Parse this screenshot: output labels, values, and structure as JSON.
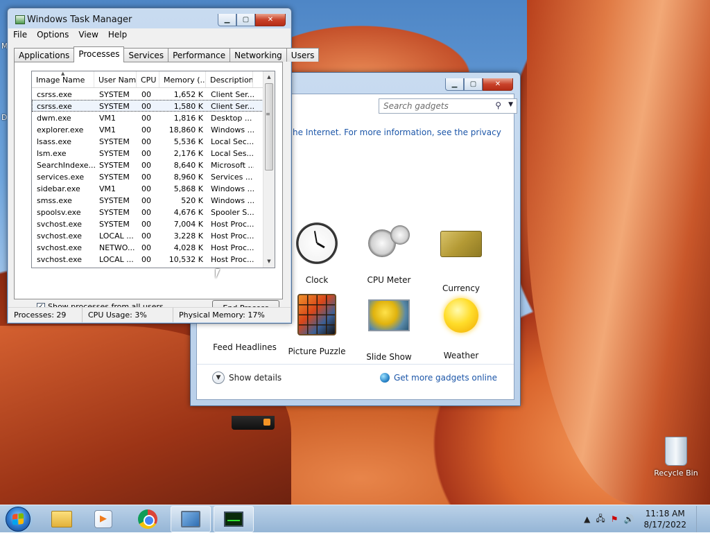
{
  "desktop": {
    "side_letters": [
      "M",
      "D"
    ],
    "recycle_bin": "Recycle Bin"
  },
  "gadgets_window": {
    "search_placeholder": "Search gadgets",
    "info_text": "he Internet.  For more information, see the privacy",
    "gadgets": [
      {
        "name": "Clock"
      },
      {
        "name": "CPU Meter"
      },
      {
        "name": "Currency"
      },
      {
        "name": "Feed Headlines"
      },
      {
        "name": "Picture Puzzle"
      },
      {
        "name": "Slide Show"
      },
      {
        "name": "Weather"
      }
    ],
    "show_details": "Show details",
    "get_more": "Get more gadgets online"
  },
  "task_manager": {
    "title": "Windows Task Manager",
    "menu": [
      "File",
      "Options",
      "View",
      "Help"
    ],
    "tabs": [
      "Applications",
      "Processes",
      "Services",
      "Performance",
      "Networking",
      "Users"
    ],
    "active_tab": "Processes",
    "columns": [
      "Image Name",
      "User Name",
      "CPU",
      "Memory (...",
      "Description"
    ],
    "rows": [
      {
        "name": "csrss.exe",
        "user": "SYSTEM",
        "cpu": "00",
        "mem": "1,652 K",
        "desc": "Client Ser..."
      },
      {
        "name": "csrss.exe",
        "user": "SYSTEM",
        "cpu": "00",
        "mem": "1,580 K",
        "desc": "Client Ser..."
      },
      {
        "name": "dwm.exe",
        "user": "VM1",
        "cpu": "00",
        "mem": "1,816 K",
        "desc": "Desktop ..."
      },
      {
        "name": "explorer.exe",
        "user": "VM1",
        "cpu": "00",
        "mem": "18,860 K",
        "desc": "Windows ..."
      },
      {
        "name": "lsass.exe",
        "user": "SYSTEM",
        "cpu": "00",
        "mem": "5,536 K",
        "desc": "Local Sec..."
      },
      {
        "name": "lsm.exe",
        "user": "SYSTEM",
        "cpu": "00",
        "mem": "2,176 K",
        "desc": "Local Ses..."
      },
      {
        "name": "SearchIndexe...",
        "user": "SYSTEM",
        "cpu": "00",
        "mem": "8,640 K",
        "desc": "Microsoft ..."
      },
      {
        "name": "services.exe",
        "user": "SYSTEM",
        "cpu": "00",
        "mem": "8,960 K",
        "desc": "Services ..."
      },
      {
        "name": "sidebar.exe",
        "user": "VM1",
        "cpu": "00",
        "mem": "5,868 K",
        "desc": "Windows ..."
      },
      {
        "name": "smss.exe",
        "user": "SYSTEM",
        "cpu": "00",
        "mem": "520 K",
        "desc": "Windows ..."
      },
      {
        "name": "spoolsv.exe",
        "user": "SYSTEM",
        "cpu": "00",
        "mem": "4,676 K",
        "desc": "Spooler S..."
      },
      {
        "name": "svchost.exe",
        "user": "SYSTEM",
        "cpu": "00",
        "mem": "7,004 K",
        "desc": "Host Proc..."
      },
      {
        "name": "svchost.exe",
        "user": "LOCAL ...",
        "cpu": "00",
        "mem": "3,228 K",
        "desc": "Host Proc..."
      },
      {
        "name": "svchost.exe",
        "user": "NETWO...",
        "cpu": "00",
        "mem": "4,028 K",
        "desc": "Host Proc..."
      },
      {
        "name": "svchost.exe",
        "user": "LOCAL ...",
        "cpu": "00",
        "mem": "10,532 K",
        "desc": "Host Proc..."
      }
    ],
    "selected_row": 1,
    "show_all_label": "Show processes from all users",
    "show_all_checked": true,
    "end_process": "End Process",
    "status": {
      "processes": "Processes: 29",
      "cpu": "CPU Usage: 3%",
      "memory": "Physical Memory: 17%"
    }
  },
  "taskbar": {
    "time": "11:18 AM",
    "date": "8/17/2022",
    "pinned": [
      "windows-explorer",
      "media-player",
      "chrome",
      "gadgets",
      "task-manager"
    ]
  }
}
